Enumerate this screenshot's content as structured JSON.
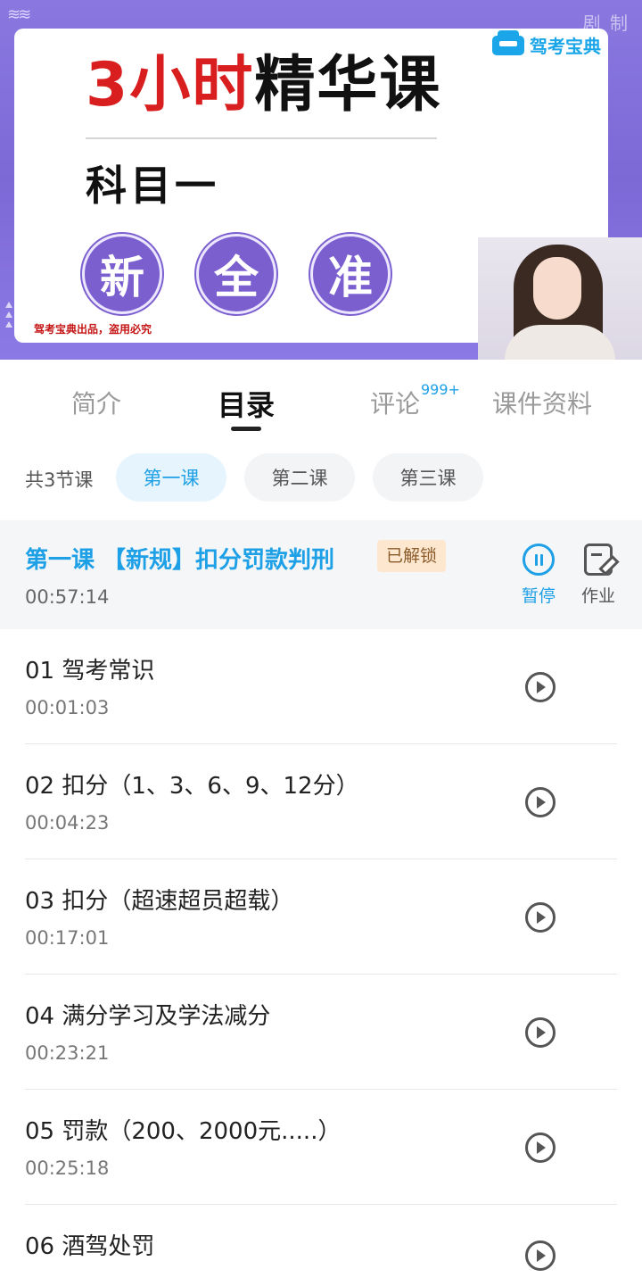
{
  "video": {
    "watermark": "剧 制",
    "brand": "驾考宝典",
    "title_red": "3小时",
    "title_black": "精华课",
    "subtitle": "科目一",
    "circles": [
      "新",
      "全",
      "准"
    ],
    "copyright": "驾考宝典出品，盗用必究"
  },
  "tabs": [
    {
      "label": "简介"
    },
    {
      "label": "目录"
    },
    {
      "label": "评论"
    },
    {
      "label": "课件资料"
    }
  ],
  "comment_badge": "999+",
  "lessons": {
    "count": "共3节课",
    "chips": [
      "第一课",
      "第二课",
      "第三课"
    ]
  },
  "current": {
    "title": "第一课 【新规】扣分罚款判刑",
    "tag": "已解锁",
    "time": "00:57:14",
    "pause_label": "暂停",
    "homework_label": "作业"
  },
  "chapters": [
    {
      "name": "01 驾考常识",
      "time": "00:01:03"
    },
    {
      "name": "02 扣分（1、3、6、9、12分）",
      "time": "00:04:23"
    },
    {
      "name": "03 扣分（超速超员超载）",
      "time": "00:17:01"
    },
    {
      "name": "04 满分学习及学法减分",
      "time": "00:23:21"
    },
    {
      "name": "05 罚款（200、2000元.....）",
      "time": "00:25:18"
    },
    {
      "name": "06 酒驾处罚",
      "time": ""
    }
  ],
  "colors": {
    "accent": "#1ea0e6",
    "title_red": "#d81e1e",
    "banner_purple": "#7d69d6",
    "tag_bg": "#fde8cf"
  }
}
